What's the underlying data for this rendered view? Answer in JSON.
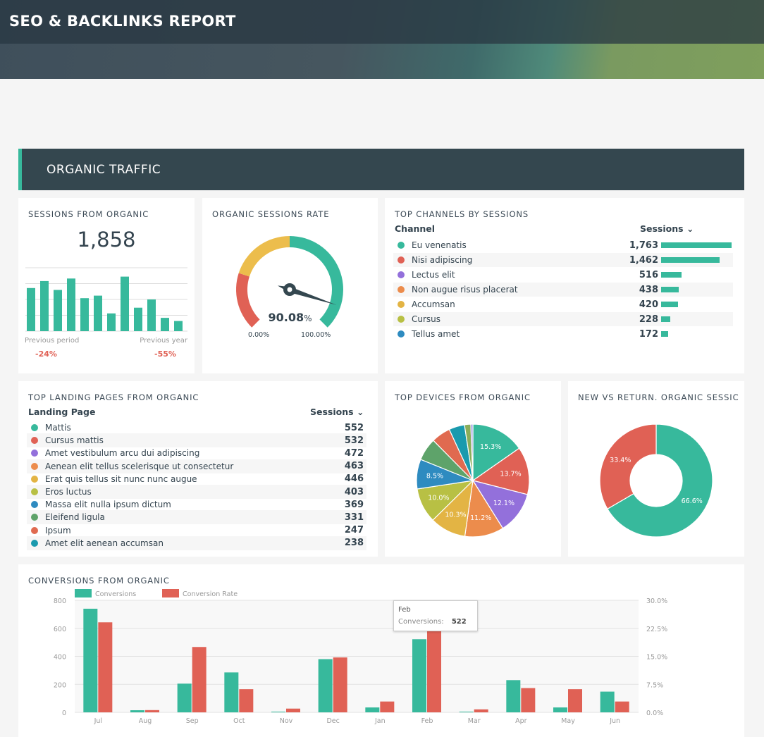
{
  "header": {
    "title": "SEO & BACKLINKS REPORT"
  },
  "section": {
    "title": "ORGANIC TRAFFIC"
  },
  "colors": {
    "teal": "#37b99c",
    "red": "#e06155",
    "yellow": "#ecbd4c",
    "dark": "#34474f"
  },
  "sessions": {
    "title": "SESSIONS FROM ORGANIC",
    "value": "1,858",
    "bars": [
      68,
      79,
      65,
      83,
      52,
      56,
      28,
      86,
      37,
      50,
      21,
      16
    ],
    "prev_period_label": "Previous period",
    "prev_period_value": "-24%",
    "prev_year_label": "Previous year",
    "prev_year_value": "-55%"
  },
  "gauge": {
    "title": "ORGANIC SESSIONS RATE",
    "value": 90.08,
    "value_label": "90.08",
    "unit": "%",
    "min_label": "0.00%",
    "max_label": "100.00%"
  },
  "channels": {
    "title": "TOP CHANNELS BY SESSIONS",
    "col1": "Channel",
    "col2": "Sessions",
    "sort_icon": "chevron-down-icon",
    "rows": [
      {
        "label": "Eu venenatis",
        "value": 1763,
        "display": "1,763",
        "color": "#37b99c"
      },
      {
        "label": "Nisi adipiscing",
        "value": 1462,
        "display": "1,462",
        "color": "#e06155"
      },
      {
        "label": "Lectus elit",
        "value": 516,
        "display": "516",
        "color": "#9370db"
      },
      {
        "label": "Non augue risus placerat",
        "value": 438,
        "display": "438",
        "color": "#ec8c4c"
      },
      {
        "label": "Accumsan",
        "value": 420,
        "display": "420",
        "color": "#e3b444"
      },
      {
        "label": "Cursus",
        "value": 228,
        "display": "228",
        "color": "#b8c044"
      },
      {
        "label": "Tellus amet",
        "value": 172,
        "display": "172",
        "color": "#2e8bc0"
      }
    ]
  },
  "landing": {
    "title": "TOP LANDING PAGES FROM ORGANIC",
    "col1": "Landing Page",
    "col2": "Sessions",
    "rows": [
      {
        "label": "Mattis",
        "display": "552",
        "color": "#37b99c"
      },
      {
        "label": "Cursus mattis",
        "display": "532",
        "color": "#e06155"
      },
      {
        "label": "Amet vestibulum arcu dui adipiscing",
        "display": "472",
        "color": "#9370db"
      },
      {
        "label": "Aenean elit tellus scelerisque ut consectetur",
        "display": "463",
        "color": "#ec8c4c"
      },
      {
        "label": "Erat quis tellus sit nunc nunc augue",
        "display": "446",
        "color": "#e3b444"
      },
      {
        "label": "Eros luctus",
        "display": "403",
        "color": "#b8c044"
      },
      {
        "label": "Massa elit nulla ipsum dictum",
        "display": "369",
        "color": "#2e8bc0"
      },
      {
        "label": "Eleifend ligula",
        "display": "331",
        "color": "#5ea36a"
      },
      {
        "label": "Ipsum",
        "display": "247",
        "color": "#e06a50"
      },
      {
        "label": "Amet elit aenean accumsan",
        "display": "238",
        "color": "#1a9aae"
      }
    ]
  },
  "chart_data": [
    {
      "type": "pie",
      "title": "TOP DEVICES FROM ORGANIC",
      "values": [
        15.3,
        13.7,
        12.1,
        11.2,
        10.3,
        10.0,
        8.5,
        6.5,
        5.5,
        4.5,
        1.8,
        0.6
      ],
      "labels": [
        "15.3%",
        "13.7%",
        "12.1%",
        "11.2%",
        "10.3%",
        "10.0%",
        "8.5%",
        "",
        "",
        "",
        "",
        ""
      ],
      "colors": [
        "#37b99c",
        "#e06155",
        "#9370db",
        "#ec8c4c",
        "#e3b444",
        "#b8c044",
        "#2e8bc0",
        "#5ea36a",
        "#e06a50",
        "#1a9aae",
        "#8aad5a",
        "#8f8fe0"
      ]
    },
    {
      "type": "pie",
      "title": "NEW VS RETURN. ORGANIC SESSIC",
      "donut": true,
      "values": [
        66.6,
        33.4
      ],
      "labels": [
        "66.6%",
        "33.4%"
      ],
      "colors": [
        "#37b99c",
        "#e06155"
      ]
    },
    {
      "type": "bar",
      "title": "CONVERSIONS FROM ORGANIC",
      "categories": [
        "Jul",
        "Aug",
        "Sep",
        "Oct",
        "Nov",
        "Dec",
        "Jan",
        "Feb",
        "Mar",
        "Apr",
        "May",
        "Jun"
      ],
      "series": [
        {
          "name": "Conversions",
          "axis": "left",
          "color": "#37b99c",
          "values": [
            740,
            15,
            205,
            285,
            5,
            380,
            35,
            522,
            5,
            230,
            35,
            148
          ]
        },
        {
          "name": "Conversion Rate",
          "axis": "right",
          "color": "#e06155",
          "values": [
            24.1,
            0.6,
            17.5,
            6.2,
            1.0,
            14.7,
            2.9,
            22.0,
            0.8,
            6.5,
            6.2,
            2.9
          ]
        }
      ],
      "ylim": [
        0,
        800
      ],
      "yticks": [
        "800",
        "600",
        "400",
        "200",
        "0"
      ],
      "y2lim": [
        0,
        30
      ],
      "y2ticks": [
        "30.0%",
        "22.5%",
        "15.0%",
        "7.5%",
        "0.0%"
      ],
      "grid": true,
      "legend": "top-left",
      "tooltip": {
        "title": "Feb",
        "label": "Conversions:",
        "value": "522"
      }
    }
  ]
}
